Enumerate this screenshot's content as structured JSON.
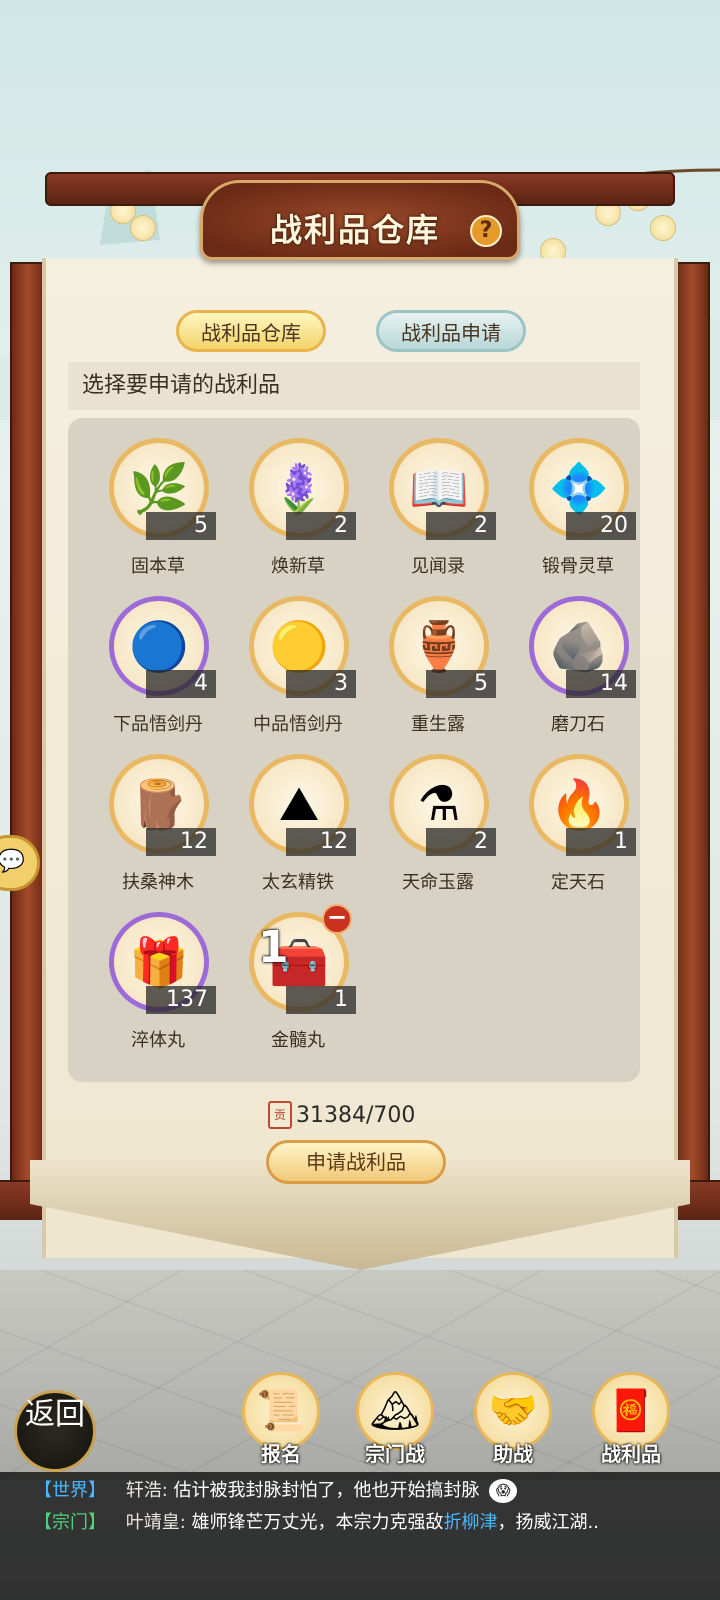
{
  "header": {
    "title": "战利品仓库",
    "help_icon": "?"
  },
  "tabs": [
    {
      "label": "战利品仓库",
      "active": true
    },
    {
      "label": "战利品申请",
      "active": false
    }
  ],
  "subtitle": "选择要申请的战利品",
  "items": [
    {
      "name": "固本草",
      "count": "5",
      "icon": "herb-icon",
      "glyph": "🌿",
      "ring": "gold"
    },
    {
      "name": "焕新草",
      "count": "2",
      "icon": "blue-flower-icon",
      "glyph": "🪻",
      "ring": "gold"
    },
    {
      "name": "见闻录",
      "count": "2",
      "icon": "book-icon",
      "glyph": "📖",
      "ring": "gold"
    },
    {
      "name": "锻骨灵草",
      "count": "20",
      "icon": "spirit-flower-icon",
      "glyph": "💠",
      "ring": "gold"
    },
    {
      "name": "下品悟剑丹",
      "count": "4",
      "icon": "teal-pill-icon",
      "glyph": "🔵",
      "ring": "purple"
    },
    {
      "name": "中品悟剑丹",
      "count": "3",
      "icon": "gold-pill-icon",
      "glyph": "🟡",
      "ring": "gold"
    },
    {
      "name": "重生露",
      "count": "5",
      "icon": "gourd-bottle-icon",
      "glyph": "🏺",
      "ring": "gold"
    },
    {
      "name": "磨刀石",
      "count": "14",
      "icon": "whetstone-icon",
      "glyph": "🪨",
      "ring": "purple"
    },
    {
      "name": "扶桑神木",
      "count": "12",
      "icon": "wood-log-icon",
      "glyph": "🪵",
      "ring": "gold"
    },
    {
      "name": "太玄精铁",
      "count": "12",
      "icon": "iron-ore-icon",
      "glyph": "⛰",
      "ring": "gold"
    },
    {
      "name": "天命玉露",
      "count": "2",
      "icon": "jade-vase-icon",
      "glyph": "⚗",
      "ring": "gold"
    },
    {
      "name": "定天石",
      "count": "1",
      "icon": "fire-stone-icon",
      "glyph": "🔥",
      "ring": "gold"
    },
    {
      "name": "淬体丸",
      "count": "137",
      "icon": "pill-chest-icon",
      "glyph": "🎁",
      "ring": "purple"
    },
    {
      "name": "金髓丸",
      "count": "1",
      "icon": "gold-chest-icon",
      "glyph": "🧰",
      "ring": "gold",
      "selected": "1"
    }
  ],
  "currency": {
    "value": "31384/700",
    "icon_text": "贡"
  },
  "apply_button": "申请战利品",
  "nav": {
    "return_label": "返回",
    "buttons": [
      {
        "label": "报名",
        "icon": "scroll-brush-icon",
        "glyph": "📜"
      },
      {
        "label": "宗门战",
        "icon": "mountain-flag-icon",
        "glyph": "🏔"
      },
      {
        "label": "助战",
        "icon": "handshake-icon",
        "glyph": "🤝"
      },
      {
        "label": "战利品",
        "icon": "treasure-chest-icon",
        "glyph": "🧧"
      }
    ]
  },
  "chat": [
    {
      "channel": "【世界】",
      "name": "轩浩:",
      "message": "估计被我封脉封怕了，他也开始搞封脉",
      "emoji": "😱"
    },
    {
      "channel": "【宗门】",
      "name": "叶靖皇:",
      "message_a": "雄师锋芒万丈光，本宗力克强敌",
      "link": "折柳津",
      "message_b": "，扬威江湖.."
    }
  ],
  "colors": {
    "frame": "#6b2a15",
    "gold_ring": "#e8b962",
    "purple_ring": "#9e6ad8"
  }
}
